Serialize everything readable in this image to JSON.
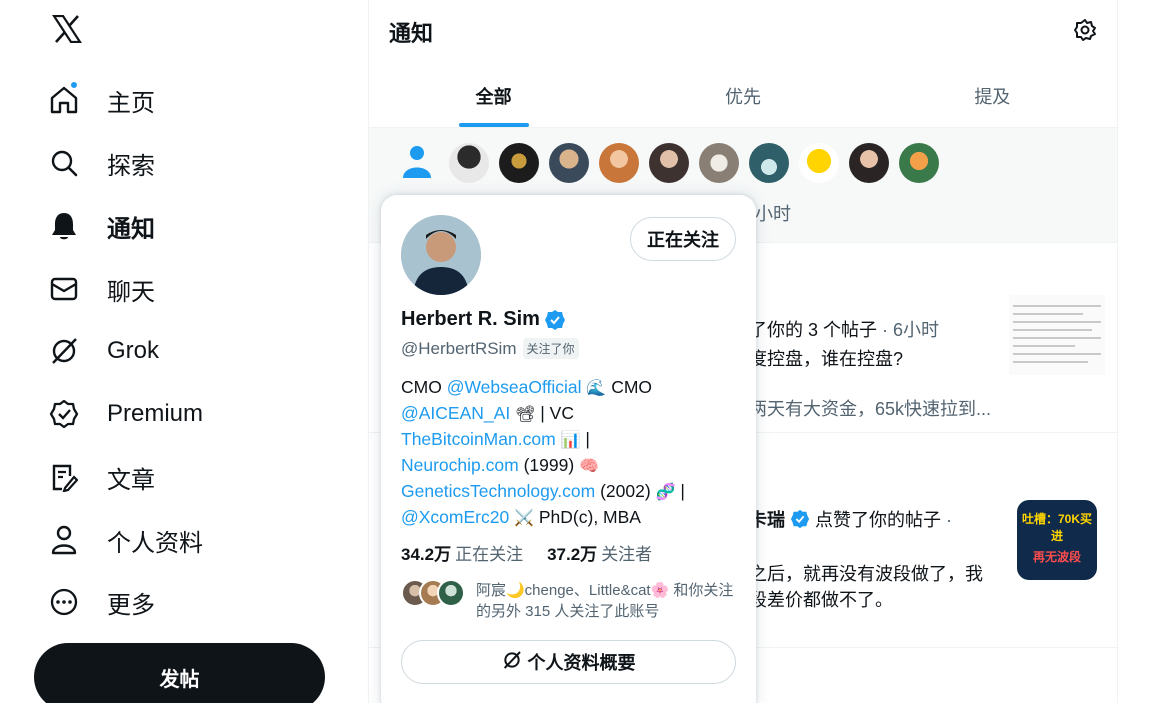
{
  "nav": {
    "items": [
      {
        "label": "主页",
        "icon": "home-icon"
      },
      {
        "label": "探索",
        "icon": "search-icon"
      },
      {
        "label": "通知",
        "icon": "bell-icon"
      },
      {
        "label": "聊天",
        "icon": "mail-icon"
      },
      {
        "label": "Grok",
        "icon": "grok-icon"
      },
      {
        "label": "Premium",
        "icon": "verified-badge-icon"
      },
      {
        "label": "文章",
        "icon": "article-icon"
      },
      {
        "label": "个人资料",
        "icon": "person-icon"
      },
      {
        "label": "更多",
        "icon": "more-icon"
      }
    ],
    "post_label": "发帖"
  },
  "header": {
    "title": "通知"
  },
  "tabs": [
    {
      "label": "全部"
    },
    {
      "label": "优先"
    },
    {
      "label": "提及"
    }
  ],
  "highlight": {
    "time": "小时"
  },
  "notifications": [
    {
      "text": "了你的 3 个帖子",
      "time": "· 6小时",
      "body": "度控盘，谁在控盘?",
      "body2": "两天有大资金，65k快速拉到..."
    },
    {
      "name_fragment": "卡瑞",
      "action": "点赞了你的帖子",
      "time": "·",
      "body": "之后，就再没有波段做了，我",
      "body2": "段差价都做不了。",
      "thumb_line1": "吐槽：70K买进",
      "thumb_line2": "再无波段"
    }
  ],
  "card": {
    "follow_label": "正在关注",
    "name": "Herbert R. Sim",
    "handle": "@HerbertRSim",
    "follows_you": "关注了你",
    "bio": {
      "p1": "CMO ",
      "l1": "@WebseaOfficial",
      "e1": "🌊",
      "p2": " CMO",
      "l2": "@AICEAN_AI",
      "e2": "📽",
      "p3": " | VC",
      "l3": "TheBitcoinMan.com",
      "e3": "📊",
      "p4": " |",
      "l4": "Neurochip.com",
      "p5": " (1999) ",
      "e5": "🧠",
      "l5": "GeneticsTechnology.com",
      "p6": " (2002) ",
      "e6": "🧬",
      "p7": " |",
      "l6": "@XcomErc20",
      "e7": "⚔️",
      "p8": " PhD(c), MBA"
    },
    "following_count": "34.2万",
    "following_label": "正在关注",
    "followers_count": "37.2万",
    "followers_label": "关注者",
    "mutuals_text": "阿宸🌙chenge、Little&cat🌸 和你关注的另外 315 人关注了此账号",
    "profile_summary_label": "个人资料概要"
  },
  "colors": {
    "accent": "#1d9bf0",
    "text": "#0f1419",
    "muted": "#536471"
  }
}
